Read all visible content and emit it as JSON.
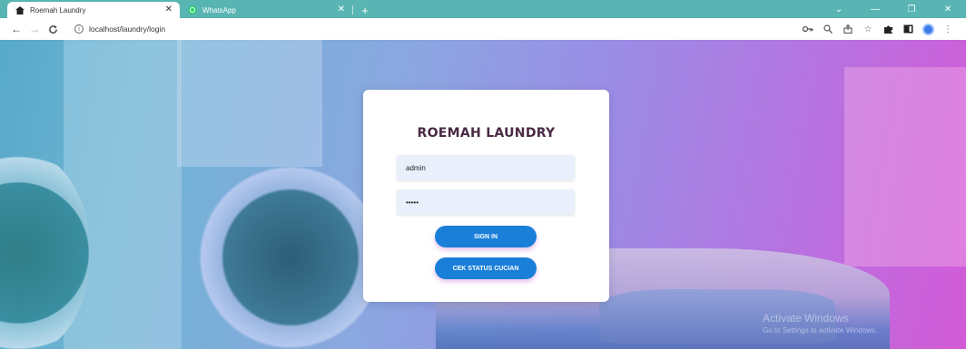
{
  "browser": {
    "tabs": [
      {
        "title": "Roemah Laundry",
        "icon": "house-icon",
        "active": true
      },
      {
        "title": "WhatsApp",
        "icon": "whatsapp-icon",
        "active": false
      }
    ],
    "new_tab": "+",
    "url": "localhost/laundry/login",
    "controls": {
      "minimize": "—",
      "maximize": "❐",
      "close": "✕",
      "dropdown": "⌄"
    }
  },
  "login": {
    "title": "ROEMAH LAUNDRY",
    "username_value": "admin",
    "password_value": "•••••",
    "signin_label": "SIGN IN",
    "status_label": "CEK STATUS CUCIAN"
  },
  "watermark": {
    "title": "Activate Windows",
    "subtitle": "Go to Settings to activate Windows."
  },
  "colors": {
    "tabstrip": "#59b5b3",
    "button": "#1a7fd8",
    "title": "#4a2a45",
    "field_bg": "#eaf0fb"
  }
}
